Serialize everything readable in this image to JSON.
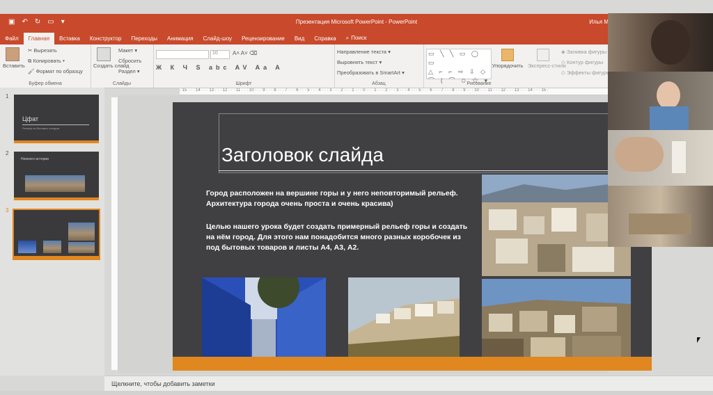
{
  "window": {
    "title": "Презентация Microsoft PowerPoint  -  PowerPoint",
    "user": "Илья М"
  },
  "tabs": [
    "Файл",
    "Главная",
    "Вставка",
    "Конструктор",
    "Переходы",
    "Анимация",
    "Слайд-шоу",
    "Рецензирование",
    "Вид",
    "Справка",
    "Поиск"
  ],
  "ribbon": {
    "clipboard": {
      "paste": "Вставить",
      "cut": "Вырезать",
      "copy": "Копировать",
      "format": "Формат по образцу",
      "label": "Буфер обмена"
    },
    "slides": {
      "create": "Создать слайд",
      "layout": "Макет",
      "reset": "Сбросить",
      "section": "Раздел",
      "label": "Слайды"
    },
    "font": {
      "size": "10",
      "label": "Шрифт"
    },
    "paragraph": {
      "direction": "Направление текста",
      "align": "Выровнять текст",
      "smartart": "Преобразовать в SmartArt",
      "label": "Абзац"
    },
    "drawing": {
      "arrange": "Упорядочить",
      "styles": "Экспресс-стили",
      "fill": "Заливка фигуры",
      "outline": "Контур фигуры",
      "effects": "Эффекты фигуры",
      "label": "Рисование"
    }
  },
  "ruler_text": "· 15 · · · 14 · · · 13 · · · 12 · · · 11 · · · 10 · · · 9 · · · 8 · · · 7 · · · 6 · · · 5 · · · 4 · · · 3 · · · 2 · · · 1 · · · 0 · · · 1 · · · 2 · · · 3 · · · 4 · · · 5 · · · 6 · · · 7 · · · 8 · · · 9 · · · 10 · · · 11 · · · 12 · · · 13 · · · 14 · · · 15 ·",
  "thumbnails": [
    {
      "num": "1",
      "title": "Цфат",
      "subtitle": "Рельеф из бытовых отходов"
    },
    {
      "num": "2",
      "title": "Немного истории"
    },
    {
      "num": "3",
      "title": ""
    }
  ],
  "slide": {
    "title": "Заголовок слайда",
    "para1": "Город расположен на вершине горы и у него неповторимый рельеф. Архитектура города очень проста и очень красива)",
    "para2": "Целью нашего урока будет создать примерный рельеф горы и создать на нём город. Для этого нам понадобится много разных коробочек из под бытовых товаров и листы А4, А3, А2."
  },
  "notes_placeholder": "Щелкните, чтобы добавить заметки",
  "colors": {
    "accent": "#c8492b",
    "slide_bg": "#404043",
    "slide_band": "#e0871f"
  }
}
